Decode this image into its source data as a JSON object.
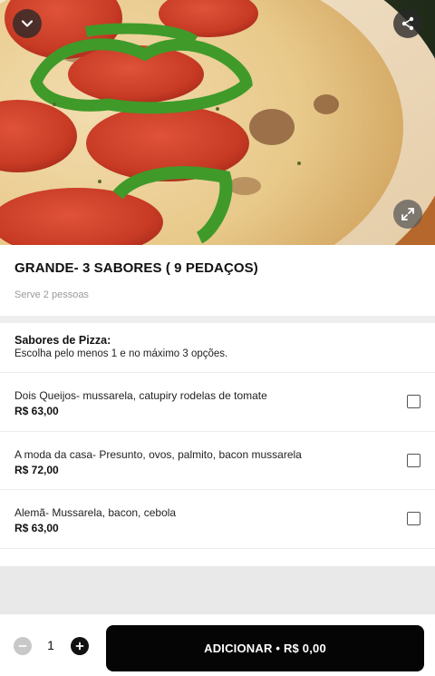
{
  "hero": {
    "image_name": "pizza-photo",
    "collapse_icon": "chevron-down-icon",
    "share_icon": "share-icon",
    "expand_icon": "expand-icon"
  },
  "product": {
    "title": "GRANDE- 3 SABORES ( 9 PEDAÇOS)",
    "serves": "Serve 2 pessoas"
  },
  "section": {
    "title": "Sabores de Pizza:",
    "subtitle": "Escolha pelo menos 1 e no máximo 3 opções."
  },
  "options": [
    {
      "name": "Dois Queijos- mussarela, catupiry rodelas de tomate",
      "price": "R$ 63,00",
      "checked": false
    },
    {
      "name": "A moda da casa- Presunto, ovos, palmito, bacon mussarela",
      "price": "R$ 72,00",
      "checked": false
    },
    {
      "name": "Alemã- Mussarela, bacon, cebola",
      "price": "R$ 63,00",
      "checked": false
    }
  ],
  "footer": {
    "quantity": "1",
    "add_label": "ADICIONAR • R$ 0,00",
    "minus_icon": "minus-icon",
    "plus_icon": "plus-icon"
  },
  "colors": {
    "primary_button": "#050505",
    "divider": "#eeeeee",
    "muted_text": "#9a9a9a"
  }
}
